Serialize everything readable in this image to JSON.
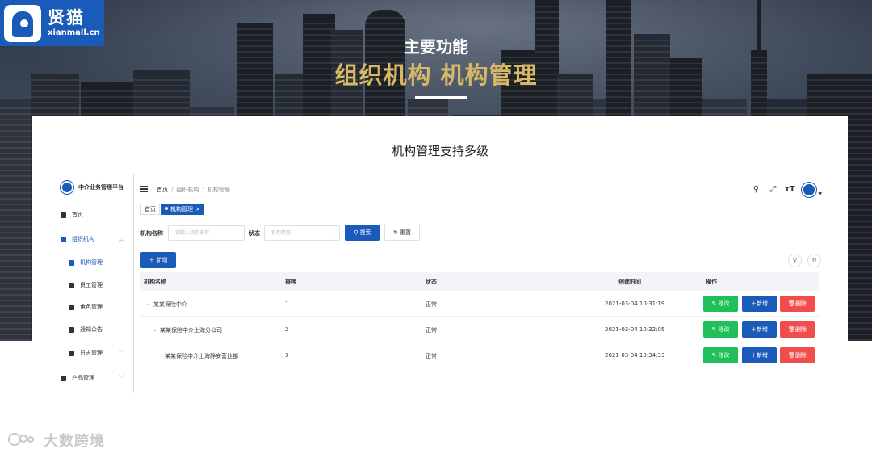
{
  "hero": {
    "logo_name": "贤猫",
    "logo_domain": "xianmall.cn",
    "subtitle": "主要功能",
    "title": "组织机构 机构管理"
  },
  "card": {
    "caption": "机构管理支持多级"
  },
  "app": {
    "platform_name": "中介业务管理平台",
    "sidebar": {
      "items": [
        {
          "label": "首页",
          "icon": "home-icon"
        },
        {
          "label": "组织机构",
          "icon": "org-icon",
          "expanded": true
        },
        {
          "label": "机构管理",
          "icon": "tree-icon",
          "active": true
        },
        {
          "label": "员工管理",
          "icon": "user-icon"
        },
        {
          "label": "角色管理",
          "icon": "users-icon"
        },
        {
          "label": "通知公告",
          "icon": "message-icon"
        },
        {
          "label": "日志管理",
          "icon": "log-icon"
        },
        {
          "label": "产品管理",
          "icon": "product-icon"
        }
      ]
    },
    "breadcrumb": [
      "首页",
      "组织机构",
      "机构管理"
    ],
    "tabs": [
      {
        "label": "首页"
      },
      {
        "label": "机构管理",
        "close": "×"
      }
    ],
    "filters": {
      "name_label": "机构名称",
      "name_placeholder": "请输入机构名称",
      "status_label": "状态",
      "status_placeholder": "机构状态",
      "search_label": "搜索",
      "reset_label": "重置"
    },
    "add_label": "新增",
    "table": {
      "headers": [
        "机构名称",
        "排序",
        "状态",
        "创建时间",
        "操作"
      ],
      "rows": [
        {
          "name": "某某保险中介",
          "order": "1",
          "status": "正常",
          "created": "2021-03-04 10:31:19",
          "level": 0
        },
        {
          "name": "某某保险中介上海分公司",
          "order": "2",
          "status": "正常",
          "created": "2021-03-04 10:32:05",
          "level": 1
        },
        {
          "name": "某某保险中介上海静安营业部",
          "order": "3",
          "status": "正常",
          "created": "2021-03-04 10:34:33",
          "level": 2
        }
      ],
      "actions": {
        "edit": "修改",
        "add": "新增",
        "delete": "删除"
      }
    }
  },
  "watermark": "大数跨境",
  "colors": {
    "primary": "#1a5ab8",
    "success": "#1fbf5a",
    "danger": "#f24d4d",
    "gold": "#d8b866"
  }
}
